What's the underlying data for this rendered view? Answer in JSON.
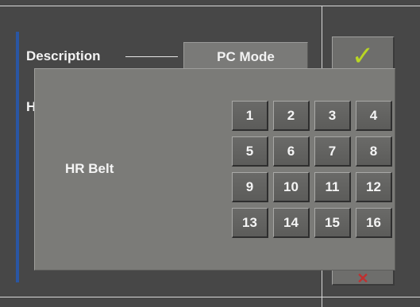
{
  "form": {
    "description_label": "Description",
    "mode_value": "PC Mode",
    "obscured_field_letter": "H"
  },
  "side_buttons": {
    "confirm_icon": "check-icon",
    "cancel_icon": "x-icon"
  },
  "colors": {
    "background": "#474747",
    "dialog": "#7b7b78",
    "accent": "#2a56a3",
    "check": "#b9d624",
    "cancel": "#c03030"
  },
  "belt_dialog": {
    "label": "HR Belt",
    "keys": [
      "1",
      "2",
      "3",
      "4",
      "5",
      "6",
      "7",
      "8",
      "9",
      "10",
      "11",
      "12",
      "13",
      "14",
      "15",
      "16"
    ]
  }
}
